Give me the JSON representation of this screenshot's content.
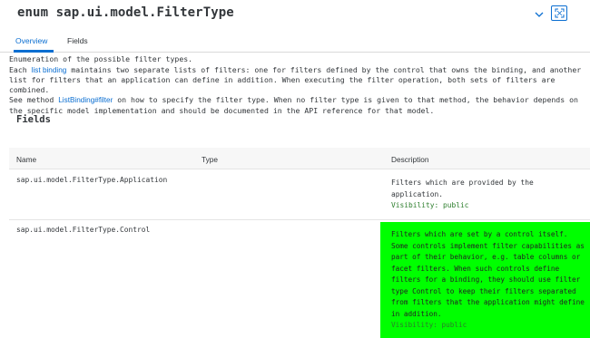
{
  "header": {
    "title": "enum sap.ui.model.FilterType"
  },
  "tabs": [
    {
      "label": "Overview",
      "active": true
    },
    {
      "label": "Fields",
      "active": false
    }
  ],
  "summary": {
    "line1": "Enumeration of the possible filter types.",
    "line2_prefix": "Each ",
    "line2_link": "list binding",
    "line2_suffix": " maintains two separate lists of filters: one for filters defined by the control that owns the binding, and another list for filters that an application can define in addition. When executing the filter operation, both sets of filters are combined.",
    "line3_prefix": "See method ",
    "line3_link": "ListBinding#filter",
    "line3_suffix": " on how to specify the filter type. When no filter type is given to that method, the behavior depends on the specific model implementation and should be documented in the API reference for that model."
  },
  "fields": {
    "title": "Fields",
    "columns": [
      "Name",
      "Type",
      "Description"
    ],
    "rows": [
      {
        "name": "sap.ui.model.FilterType.Application",
        "type": "",
        "description": "Filters which are provided by the application.",
        "visibility": "Visibility: public"
      },
      {
        "name": "sap.ui.model.FilterType.Control",
        "type": "",
        "description": "Filters which are set by a control itself. Some controls implement filter capabilities as part of their behavior, e.g. table columns or facet filters. When such controls define filters for a binding, they should use filter type Control to keep their filters separated from filters that the application might define in addition.",
        "visibility": "Visibility: public"
      }
    ]
  },
  "colors": {
    "accent": "#0a6ed1",
    "highlight": "#00ff00",
    "visibility": "#2b7d2b"
  },
  "icons": [
    "chevron-down-icon",
    "expand-icon"
  ]
}
